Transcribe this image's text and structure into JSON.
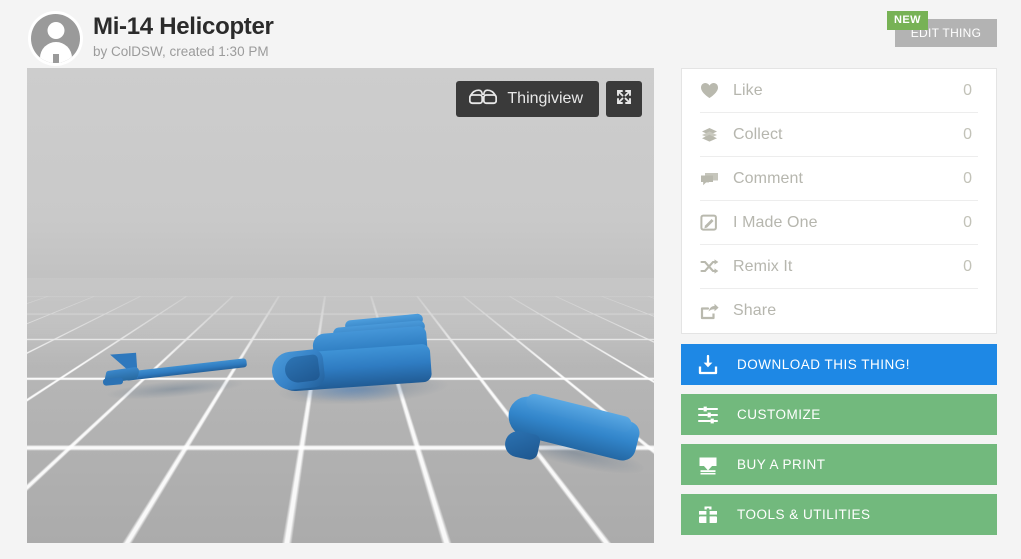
{
  "header": {
    "avatar_icon": "user-avatar-icon",
    "title": "Mi-14 Helicopter",
    "byline": "by ColDSW, created 1:30 PM",
    "new_badge": "NEW",
    "edit_button": "EDIT THING",
    "new_badge_color": "#77b255",
    "edit_button_color": "#b3b3b3"
  },
  "viewer": {
    "thingiview_label": "Thingiview",
    "thingiview_icon": "3d-glasses-icon",
    "fullscreen_icon": "fullscreen-expand-icon",
    "toolbar_background": "#3a3a3a",
    "model_color": "#2f7cc2",
    "floor_color": "#b7b7b7",
    "grid_line_color": "#ffffff"
  },
  "sidebar": {
    "stats": [
      {
        "icon": "heart-icon",
        "label": "Like",
        "count": "0"
      },
      {
        "icon": "layers-icon",
        "label": "Collect",
        "count": "0"
      },
      {
        "icon": "comment-icon",
        "label": "Comment",
        "count": "0"
      },
      {
        "icon": "pencil-square-icon",
        "label": "I Made One",
        "count": "0"
      },
      {
        "icon": "shuffle-icon",
        "label": "Remix It",
        "count": "0"
      },
      {
        "icon": "share-icon",
        "label": "Share",
        "count": ""
      }
    ],
    "actions": [
      {
        "icon": "download-icon",
        "label": "DOWNLOAD THIS THING!",
        "color": "#1e88e5"
      },
      {
        "icon": "sliders-icon",
        "label": "CUSTOMIZE",
        "color": "#72b97d"
      },
      {
        "icon": "printer-icon",
        "label": "BUY A PRINT",
        "color": "#72b97d"
      },
      {
        "icon": "toolbox-icon",
        "label": "TOOLS & UTILITIES",
        "color": "#72b97d"
      }
    ]
  }
}
